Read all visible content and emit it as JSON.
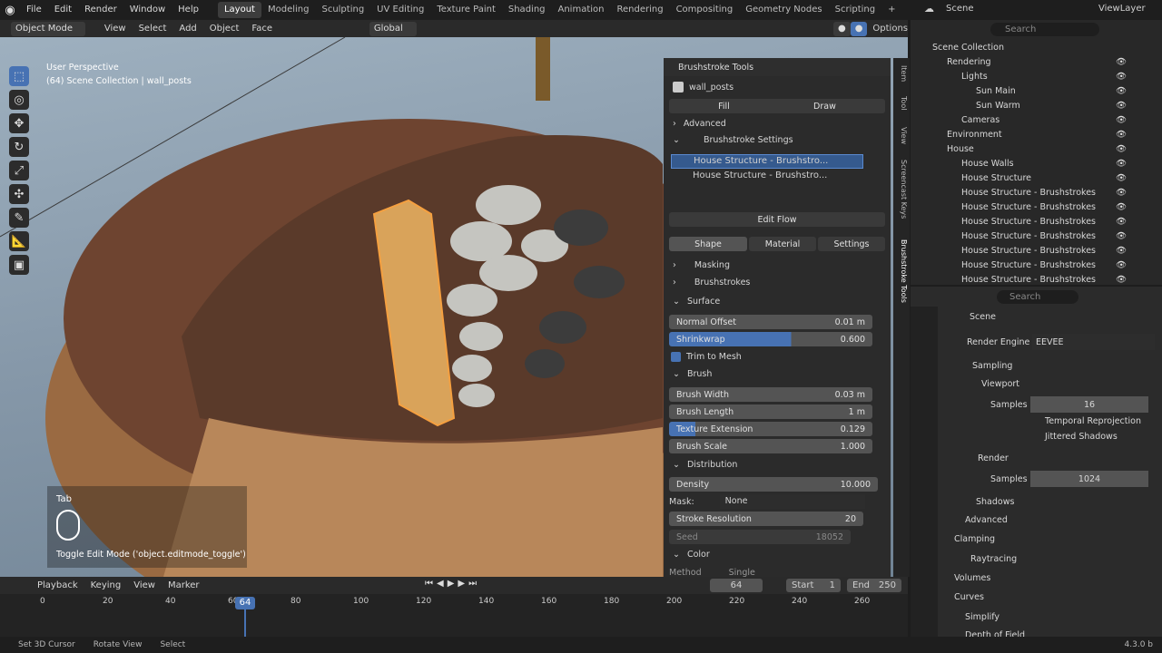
{
  "menus": [
    "File",
    "Edit",
    "Render",
    "Window",
    "Help"
  ],
  "workspaces": [
    "Layout",
    "Modeling",
    "Sculpting",
    "UV Editing",
    "Texture Paint",
    "Shading",
    "Animation",
    "Rendering",
    "Compositing",
    "Geometry Nodes",
    "Scripting"
  ],
  "scene_name": "Scene",
  "viewlayer_name": "ViewLayer",
  "viewport_header": {
    "mode": "Object Mode",
    "menus": [
      "View",
      "Select",
      "Add",
      "Object",
      "Face"
    ],
    "orientation": "Global",
    "options": "Options"
  },
  "viewport": {
    "perspective": "User Perspective",
    "collection_info": "(64) Scene Collection | wall_posts",
    "key_label": "Tab",
    "operator_hint": "Toggle Edit Mode ('object.editmode_toggle')"
  },
  "npanel": {
    "title": "Brushstroke Tools",
    "object": "wall_posts",
    "fill": "Fill",
    "draw": "Draw",
    "advanced": "Advanced",
    "brushstroke_settings": "Brushstroke Settings",
    "list": [
      "House Structure - Brushstro...",
      "House Structure - Brushstro..."
    ],
    "edit_flow": "Edit Flow",
    "tabs": [
      "Shape",
      "Material",
      "Settings"
    ],
    "masking": "Masking",
    "brushstrokes": "Brushstrokes",
    "surface": "Surface",
    "normal_offset": {
      "label": "Normal Offset",
      "value": "0.01 m"
    },
    "shrinkwrap": {
      "label": "Shrinkwrap",
      "value": "0.600"
    },
    "trim": "Trim to Mesh",
    "brush": "Brush",
    "brush_width": {
      "label": "Brush Width",
      "value": "0.03 m"
    },
    "brush_length": {
      "label": "Brush Length",
      "value": "1 m"
    },
    "texture_extension": {
      "label": "Texture Extension",
      "value": "0.129"
    },
    "brush_scale": {
      "label": "Brush Scale",
      "value": "1.000"
    },
    "distribution": "Distribution",
    "density": {
      "label": "Density",
      "value": "10.000"
    },
    "mask": {
      "label": "Mask:",
      "value": "None"
    },
    "stroke_resolution": {
      "label": "Stroke Resolution",
      "value": "20"
    },
    "seed": {
      "label": "Seed",
      "value": "18052"
    },
    "color": "Color",
    "method": {
      "label": "Method",
      "value": "Single"
    }
  },
  "sidetabs": [
    "Item",
    "Tool",
    "View",
    "Screencast Keys",
    "Brushstroke Tools"
  ],
  "outliner": {
    "search": "Search",
    "rows": [
      {
        "label": "Scene Collection",
        "indent": 0
      },
      {
        "label": "Rendering",
        "indent": 1
      },
      {
        "label": "Lights",
        "indent": 2
      },
      {
        "label": "Sun Main",
        "indent": 3
      },
      {
        "label": "Sun Warm",
        "indent": 3
      },
      {
        "label": "Cameras",
        "indent": 2
      },
      {
        "label": "Environment",
        "indent": 1
      },
      {
        "label": "House",
        "indent": 1
      },
      {
        "label": "House Walls",
        "indent": 2
      },
      {
        "label": "House Structure",
        "indent": 2
      },
      {
        "label": "House Structure - Brushstrokes",
        "indent": 2
      },
      {
        "label": "House Structure - Brushstrokes",
        "indent": 2
      },
      {
        "label": "House Structure - Brushstrokes",
        "indent": 2
      },
      {
        "label": "House Structure - Brushstrokes",
        "indent": 2
      },
      {
        "label": "House Structure - Brushstrokes",
        "indent": 2
      },
      {
        "label": "House Structure - Brushstrokes",
        "indent": 2
      },
      {
        "label": "House Structure - Brushstrokes",
        "indent": 2
      }
    ]
  },
  "properties": {
    "search": "Search",
    "scene": "Scene",
    "render_engine": {
      "label": "Render Engine",
      "value": "EEVEE"
    },
    "sampling": "Sampling",
    "viewport": "Viewport",
    "samples_vp": {
      "label": "Samples",
      "value": "16"
    },
    "temporal": "Temporal Reprojection",
    "jittered": "Jittered Shadows",
    "render": "Render",
    "samples_r": {
      "label": "Samples",
      "value": "1024"
    },
    "shadows": "Shadows",
    "advanced": "Advanced",
    "clamping": "Clamping",
    "raytracing": "Raytracing",
    "volumes": "Volumes",
    "curves": "Curves",
    "simplify": "Simplify",
    "dof": "Depth of Field"
  },
  "timeline": {
    "menus": [
      "Playback",
      "Keying",
      "View",
      "Marker"
    ],
    "current_frame": "64",
    "start_label": "Start",
    "start": "1",
    "end_label": "End",
    "end": "250",
    "ticks": [
      "0",
      "20",
      "40",
      "60",
      "80",
      "100",
      "120",
      "140",
      "160",
      "180",
      "200",
      "220",
      "240",
      "260"
    ]
  },
  "statusbar": {
    "items": [
      "Set 3D Cursor",
      "Rotate View",
      "Select"
    ],
    "version": "4.3.0 b"
  }
}
